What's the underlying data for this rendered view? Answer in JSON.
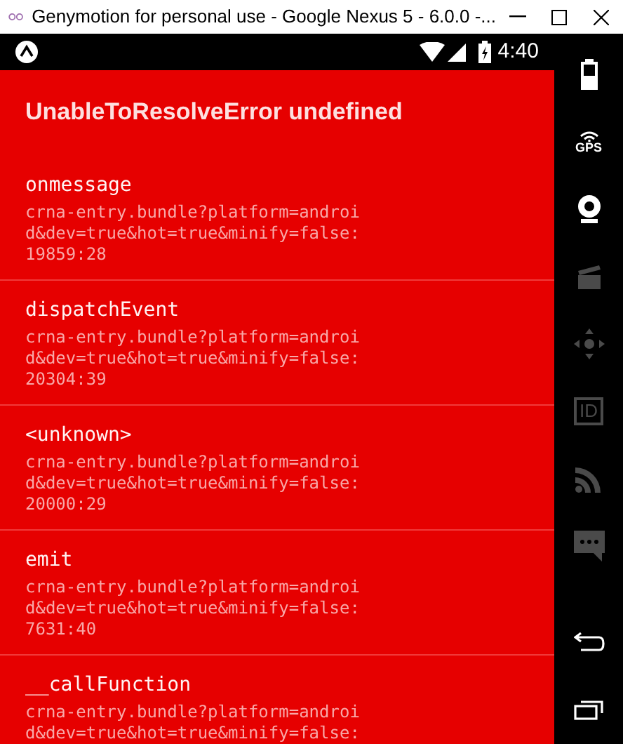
{
  "window": {
    "title": "Genymotion for personal use - Google Nexus 5 - 6.0.0 -..."
  },
  "status_bar": {
    "time": "4:40"
  },
  "error": {
    "title": "UnableToResolveError undefined",
    "frames": [
      {
        "method": "onmessage",
        "location": "crna-entry.bundle?platform=androi\nd&dev=true&hot=true&minify=false:\n19859:28"
      },
      {
        "method": "dispatchEvent",
        "location": "crna-entry.bundle?platform=androi\nd&dev=true&hot=true&minify=false:\n20304:39"
      },
      {
        "method": "<unknown>",
        "location": "crna-entry.bundle?platform=androi\nd&dev=true&hot=true&minify=false:\n20000:29"
      },
      {
        "method": "emit",
        "location": "crna-entry.bundle?platform=androi\nd&dev=true&hot=true&minify=false:\n7631:40"
      },
      {
        "method": "__callFunction",
        "location": "crna-entry.bundle?platform=androi\nd&dev=true&hot=true&minify=false:"
      }
    ]
  },
  "toolbar": [
    {
      "kind": "battery",
      "disabled": false
    },
    {
      "kind": "gps",
      "label": "GPS",
      "disabled": false
    },
    {
      "kind": "webcam",
      "disabled": false
    },
    {
      "kind": "capture",
      "disabled": true
    },
    {
      "kind": "dpad",
      "disabled": true
    },
    {
      "kind": "id",
      "label": "ID",
      "disabled": true
    },
    {
      "kind": "network",
      "disabled": true
    },
    {
      "kind": "sms",
      "disabled": true
    },
    {
      "kind": "spacer"
    },
    {
      "kind": "back",
      "disabled": false
    },
    {
      "kind": "recents",
      "disabled": false
    }
  ]
}
